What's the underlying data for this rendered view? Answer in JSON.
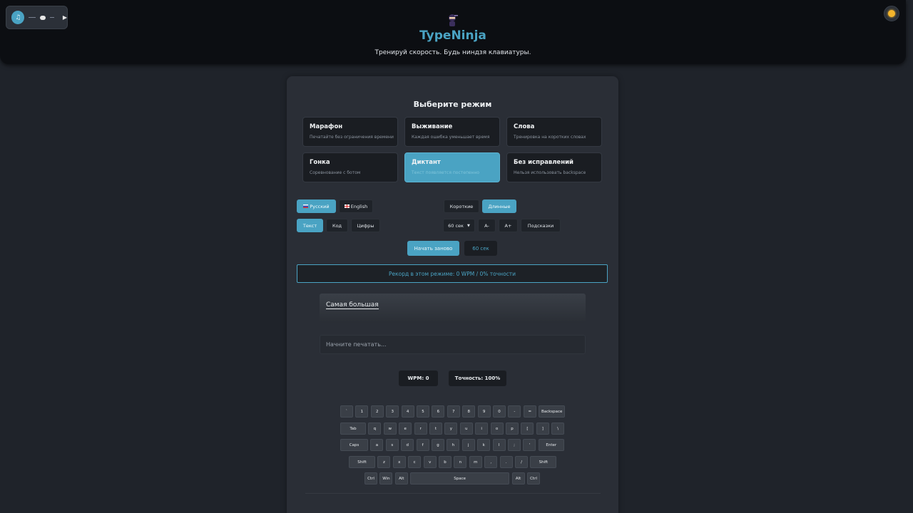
{
  "header": {
    "title": "TypeNinja",
    "tagline": "Тренируй скорость. Будь ниндзя клавиатуры.",
    "logo_icon": "ninja-icon",
    "theme_icon": "sun-icon",
    "audio": {
      "toggle_icon": "audio-icon",
      "play_icon": "play-icon"
    }
  },
  "mode_section": {
    "title": "Выберите режим",
    "modes": [
      {
        "name": "Марафон",
        "desc": "Печатайте без ограничения времени"
      },
      {
        "name": "Выживание",
        "desc": "Каждая ошибка уменьшает время"
      },
      {
        "name": "Слова",
        "desc": "Тренировка на коротких словах"
      },
      {
        "name": "Гонка",
        "desc": "Соревнование с ботом"
      },
      {
        "name": "Диктант",
        "desc": "Текст появляется постепенно",
        "active": true
      },
      {
        "name": "Без исправлений",
        "desc": "Нельзя использовать backspace"
      }
    ]
  },
  "settings": {
    "languages": [
      "Русский",
      "English"
    ],
    "language_selected": "Русский",
    "lengths": [
      "Короткие",
      "Длинные"
    ],
    "length_selected": "Длинные",
    "content_types": [
      "Текст",
      "Код",
      "Цифры"
    ],
    "content_selected": "Текст",
    "time_select": "60 сек",
    "font_minus": "A-",
    "font_plus": "A+",
    "hints": "Подсказки"
  },
  "controls": {
    "restart_label": "Начать заново",
    "timer": "60 сек"
  },
  "record": "Рекорд в этом режиме: 0 WPM / 0% точности",
  "typing": {
    "display_text": "Самая большая",
    "placeholder": "Начните печатать..."
  },
  "stats": {
    "wpm": "WPM: 0",
    "accuracy": "Точность: 100%"
  },
  "keyboard": {
    "row1": [
      "`",
      "1",
      "2",
      "3",
      "4",
      "5",
      "6",
      "7",
      "8",
      "9",
      "0",
      "-",
      "=",
      "Backspace"
    ],
    "row2": [
      "Tab",
      "q",
      "w",
      "e",
      "r",
      "t",
      "y",
      "u",
      "i",
      "o",
      "p",
      "[",
      "]",
      "\\"
    ],
    "row3": [
      "Caps",
      "a",
      "s",
      "d",
      "f",
      "g",
      "h",
      "j",
      "k",
      "l",
      ";",
      "'",
      "Enter"
    ],
    "row4": [
      "Shift",
      "z",
      "x",
      "c",
      "v",
      "b",
      "n",
      "m",
      ",",
      ".",
      "/",
      "Shift"
    ],
    "row5": [
      "Ctrl",
      "Win",
      "Alt",
      "Space",
      "Alt",
      "Ctrl"
    ]
  },
  "colors": {
    "accent": "#4aa3c3",
    "background": "#1f232a",
    "panel": "#2a2e36"
  }
}
